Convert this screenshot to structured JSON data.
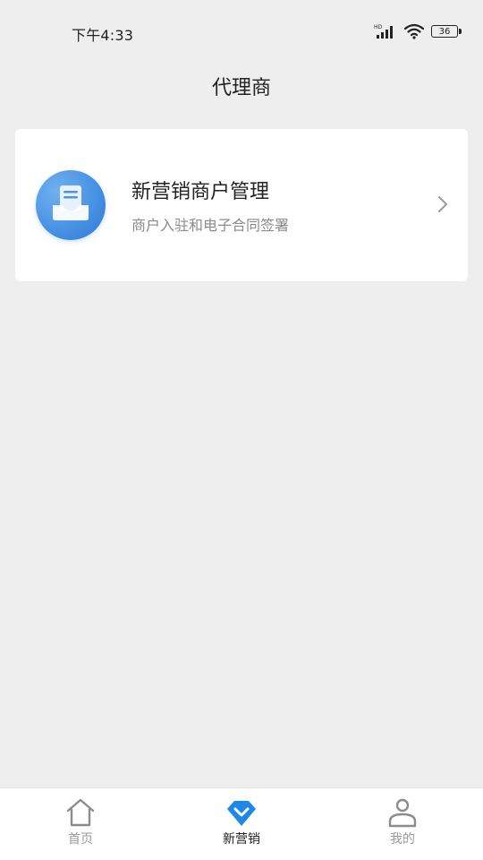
{
  "status_bar": {
    "time": "下午4:33",
    "battery": "36",
    "icons": [
      "hd-signal-icon",
      "wifi-icon",
      "battery-icon"
    ]
  },
  "page": {
    "title": "代理商"
  },
  "card": {
    "title": "新营销商户管理",
    "subtitle": "商户入驻和电子合同签署",
    "icon": "inbox-document-icon",
    "accent": "#3f8ae0"
  },
  "bottom_nav": {
    "items": [
      {
        "label": "首页",
        "icon": "home-icon",
        "active": false
      },
      {
        "label": "新营销",
        "icon": "marketing-diamond-icon",
        "active": true
      },
      {
        "label": "我的",
        "icon": "user-icon",
        "active": false
      }
    ],
    "active_color": "#1e88e5",
    "inactive_color": "#9a9a9a"
  }
}
